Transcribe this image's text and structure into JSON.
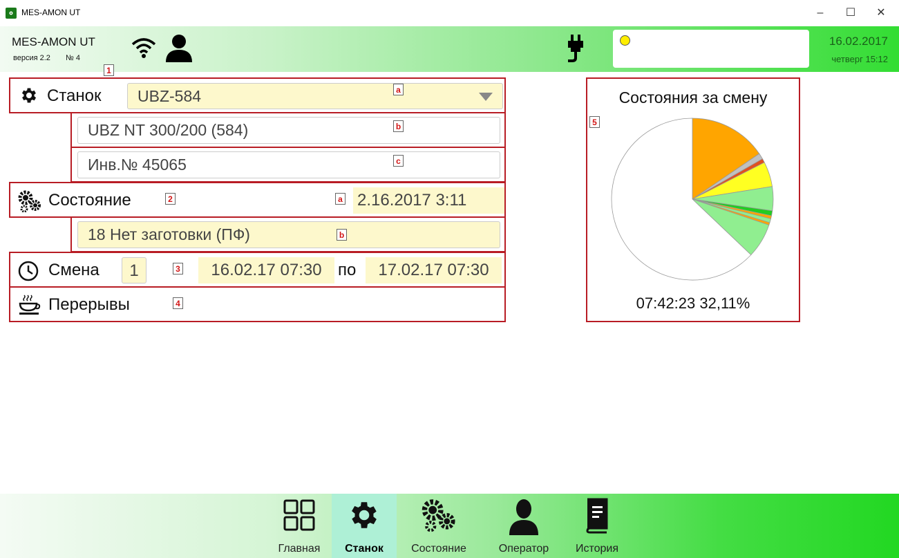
{
  "window": {
    "title": "MES-AMON UT",
    "minimize": "–",
    "maximize": "☐",
    "close": "✕"
  },
  "header": {
    "app_name": "MES-AMON UT",
    "version": "версия 2.2",
    "number": "№ 4",
    "date": "16.02.2017",
    "day_time": "четверг  15:12",
    "status_color": "#ffee00"
  },
  "badges": {
    "b1": "1",
    "b1a": "a",
    "b1b": "b",
    "b1c": "c",
    "b2": "2",
    "b2a": "a",
    "b2b": "b",
    "b3": "3",
    "b4": "4",
    "b5": "5"
  },
  "machine": {
    "label": "Станок",
    "selected": "UBZ-584",
    "model": "UBZ NT 300/200 (584)",
    "inventory": "Инв.№ 45065"
  },
  "state": {
    "label": "Состояние",
    "timestamp": "2.16.2017 3:11",
    "value": "18 Нет заготовки (ПФ)"
  },
  "shift": {
    "label": "Смена",
    "number": "1",
    "from": "16.02.17 07:30",
    "to_word": "по",
    "to": "17.02.17 07:30"
  },
  "breaks": {
    "label": "Перерывы"
  },
  "chart_data": {
    "type": "pie",
    "title": "Состояния за смену",
    "caption": "07:42:23  32,11%",
    "slices": [
      {
        "value": 15.5,
        "color": "#ffa500"
      },
      {
        "value": 1.2,
        "color": "#c0c0c0"
      },
      {
        "value": 0.8,
        "color": "#e05020"
      },
      {
        "value": 5.0,
        "color": "#ffff22"
      },
      {
        "value": 4.8,
        "color": "#90ee90"
      },
      {
        "value": 1.0,
        "color": "#22cc22"
      },
      {
        "value": 0.6,
        "color": "#ffa500"
      },
      {
        "value": 0.8,
        "color": "#90ee90"
      },
      {
        "value": 0.5,
        "color": "#ffa500"
      },
      {
        "value": 6.9,
        "color": "#90ee90"
      },
      {
        "value": 62.9,
        "color": "#ffffff"
      }
    ]
  },
  "nav": {
    "items": [
      {
        "label": "Главная",
        "icon": "grid-icon"
      },
      {
        "label": "Станок",
        "icon": "gear-icon"
      },
      {
        "label": "Состояние",
        "icon": "gears-icon"
      },
      {
        "label": "Оператор",
        "icon": "person-icon"
      },
      {
        "label": "История",
        "icon": "book-icon"
      }
    ],
    "active": "Станок"
  }
}
